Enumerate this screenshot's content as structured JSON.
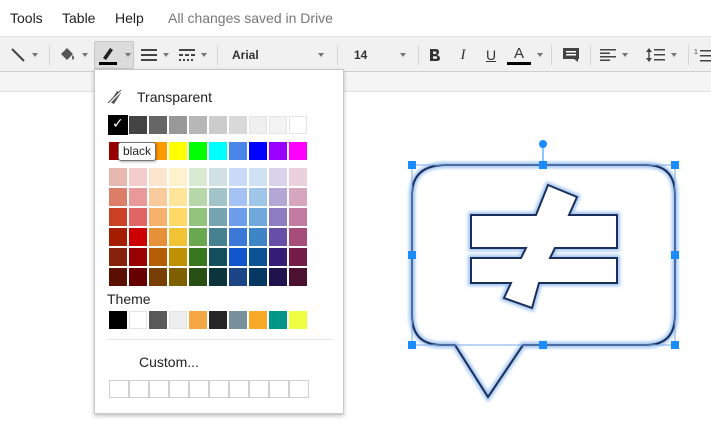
{
  "menubar": {
    "items": [
      "Tools",
      "Table",
      "Help"
    ],
    "save_status": "All changes saved in Drive"
  },
  "toolbar": {
    "font_family": "Arial",
    "font_size": "14",
    "italic_label": "I",
    "underline_label": "U",
    "text_color_label": "A",
    "line_tool": "line-icon",
    "fill_tool": "paint-bucket-icon",
    "pen_tool": "pen-icon",
    "line_weight_tool": "line-weight-icon",
    "line_dash_tool": "line-dash-icon",
    "bold_tool": "bold-icon",
    "comment_tool": "comment-icon",
    "align_tool": "align-left-icon",
    "line_spacing_tool": "line-spacing-icon",
    "numbered_list_tool": "numbered-list-icon",
    "numbered_list_label": "1"
  },
  "color_picker": {
    "transparent_label": "Transparent",
    "tooltip": "black",
    "theme_label": "Theme",
    "custom_label": "Custom...",
    "selected_color": "#000000",
    "grays": [
      "#000000",
      "#434343",
      "#666666",
      "#999999",
      "#b7b7b7",
      "#cccccc",
      "#d9d9d9",
      "#efefef",
      "#f3f3f3",
      "#ffffff"
    ],
    "brights": [
      "#980000",
      "#ff0000",
      "#ff9900",
      "#ffff00",
      "#00ff00",
      "#00ffff",
      "#4a86e8",
      "#0000ff",
      "#9900ff",
      "#ff00ff"
    ],
    "palette": [
      [
        "#e6b8af",
        "#f4cccc",
        "#fce5cd",
        "#fff2cc",
        "#d9ead3",
        "#d0e0e3",
        "#c9daf8",
        "#cfe2f3",
        "#d9d2e9",
        "#ead1dc"
      ],
      [
        "#dd7e6b",
        "#ea9999",
        "#f9cb9c",
        "#ffe599",
        "#b6d7a8",
        "#a2c4c9",
        "#a4c2f4",
        "#9fc5e8",
        "#b4a7d6",
        "#d5a6bd"
      ],
      [
        "#cc4125",
        "#e06666",
        "#f6b26b",
        "#ffd966",
        "#93c47d",
        "#76a5af",
        "#6d9eeb",
        "#6fa8dc",
        "#8e7cc3",
        "#c27ba0"
      ],
      [
        "#a61c00",
        "#cc0000",
        "#e69138",
        "#f1c232",
        "#6aa84f",
        "#45818e",
        "#3c78d8",
        "#3d85c6",
        "#674ea7",
        "#a64d79"
      ],
      [
        "#85200c",
        "#990000",
        "#b45f06",
        "#bf9000",
        "#38761d",
        "#134f5c",
        "#1155cc",
        "#0b5394",
        "#351c75",
        "#741b47"
      ],
      [
        "#5b0f00",
        "#660000",
        "#783f04",
        "#7f6000",
        "#274e13",
        "#0c343d",
        "#1c4587",
        "#073763",
        "#20124d",
        "#4c1130"
      ]
    ],
    "theme_colors": [
      "#000000",
      "#ffffff",
      "#595959",
      "#eeeeee",
      "#f4a742",
      "#262626",
      "#78909c",
      "#f9a825",
      "#009688",
      "#eeff41"
    ]
  },
  "colors": {
    "accent": "#1a73e8",
    "selection_handle": "#1a8cff",
    "shape_stroke": "#1c2f5c",
    "shape_glow": "#9ec3ef"
  }
}
